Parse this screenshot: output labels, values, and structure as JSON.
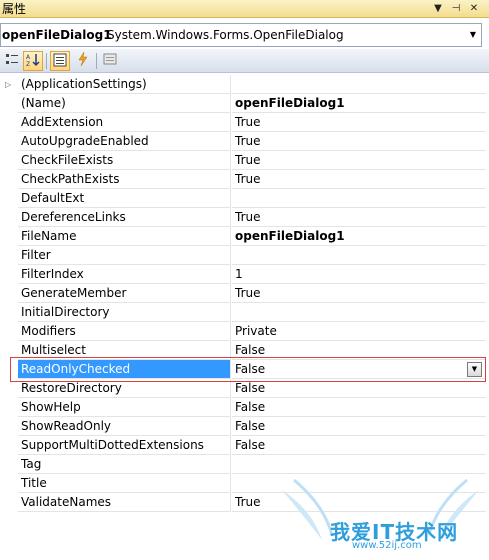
{
  "panel": {
    "title": "属性"
  },
  "object_selector": {
    "name": "openFileDialog1",
    "type": "System.Windows.Forms.OpenFileDialog"
  },
  "toolbar": {
    "buttons": [
      "categorized-view",
      "alphabetical-view",
      "properties-view",
      "events-view",
      "property-pages"
    ]
  },
  "properties": [
    {
      "name": "(ApplicationSettings)",
      "value": "",
      "expandable": true
    },
    {
      "name": "(Name)",
      "value": "openFileDialog1",
      "bold": true
    },
    {
      "name": "AddExtension",
      "value": "True"
    },
    {
      "name": "AutoUpgradeEnabled",
      "value": "True"
    },
    {
      "name": "CheckFileExists",
      "value": "True"
    },
    {
      "name": "CheckPathExists",
      "value": "True"
    },
    {
      "name": "DefaultExt",
      "value": ""
    },
    {
      "name": "DereferenceLinks",
      "value": "True"
    },
    {
      "name": "FileName",
      "value": "openFileDialog1",
      "bold": true
    },
    {
      "name": "Filter",
      "value": ""
    },
    {
      "name": "FilterIndex",
      "value": "1"
    },
    {
      "name": "GenerateMember",
      "value": "True"
    },
    {
      "name": "InitialDirectory",
      "value": ""
    },
    {
      "name": "Modifiers",
      "value": "Private"
    },
    {
      "name": "Multiselect",
      "value": "False"
    },
    {
      "name": "ReadOnlyChecked",
      "value": "False",
      "selected": true
    },
    {
      "name": "RestoreDirectory",
      "value": "False"
    },
    {
      "name": "ShowHelp",
      "value": "False"
    },
    {
      "name": "ShowReadOnly",
      "value": "False"
    },
    {
      "name": "SupportMultiDottedExtensions",
      "value": "False"
    },
    {
      "name": "Tag",
      "value": ""
    },
    {
      "name": "Title",
      "value": ""
    },
    {
      "name": "ValidateNames",
      "value": "True"
    }
  ],
  "watermark": {
    "title": "我爱IT技术网",
    "url": "www.52ij.com"
  },
  "colors": {
    "selection": "#3399ff",
    "highlight_border": "#d94040",
    "titlebar": "#f3dc8e"
  }
}
